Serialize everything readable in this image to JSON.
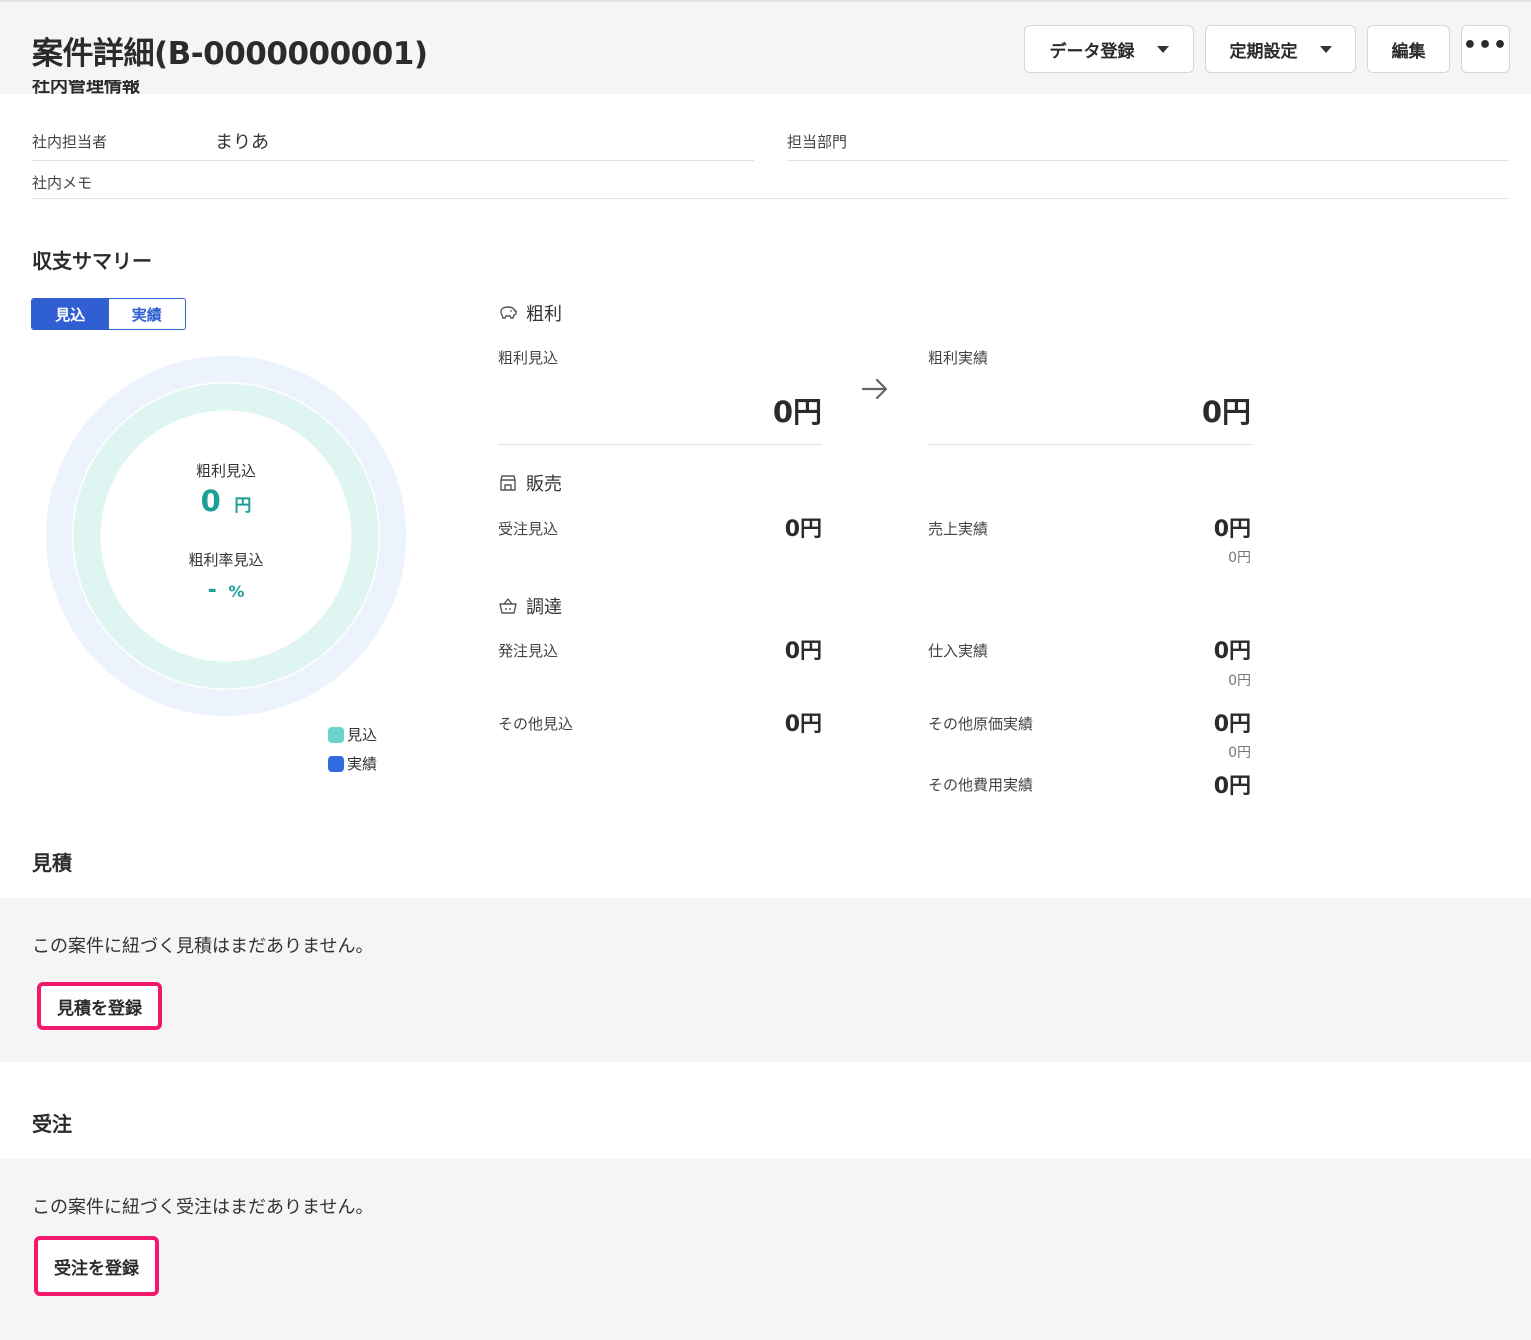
{
  "header": {
    "title": "案件詳細(B-0000000001)",
    "buttons": {
      "data_register": "データ登録",
      "periodic_setting": "定期設定",
      "edit": "編集",
      "more": "•••"
    }
  },
  "internal": {
    "section_title_cut": "社内管理情報",
    "person_label": "社内担当者",
    "person_value": "まりあ",
    "dept_label": "担当部門",
    "memo_label": "社内メモ"
  },
  "summary": {
    "title": "収支サマリー",
    "toggle": {
      "forecast": "見込",
      "actual": "実績"
    },
    "donut": {
      "profit_label": "粗利見込",
      "profit_value": "0",
      "profit_unit": "円",
      "rate_label": "粗利率見込",
      "rate_value": "-",
      "rate_unit": "%"
    },
    "legend": [
      {
        "label": "見込",
        "color": "#6cd3cf"
      },
      {
        "label": "実績",
        "color": "#2f6be0"
      }
    ],
    "profit": {
      "category": "粗利",
      "forecast_label": "粗利見込",
      "forecast_value": "0円",
      "actual_label": "粗利実績",
      "actual_value": "0円"
    },
    "sales": {
      "category": "販売",
      "forecast_label": "受注見込",
      "forecast_value": "0円",
      "actual_label": "売上実績",
      "actual_value": "0円",
      "actual_sub": "0円"
    },
    "procurement": {
      "category": "調達",
      "forecast_label": "発注見込",
      "forecast_value": "0円",
      "actual_label": "仕入実績",
      "actual_value": "0円",
      "actual_sub": "0円"
    },
    "other": {
      "forecast_label": "その他見込",
      "forecast_value": "0円",
      "cost_label": "その他原価実績",
      "cost_value": "0円",
      "cost_sub": "0円",
      "expense_label": "その他費用実績",
      "expense_value": "0円"
    }
  },
  "estimate": {
    "title": "見積",
    "empty_text": "この案件に紐づく見積はまだありません。",
    "button": "見積を登録"
  },
  "order": {
    "title": "受注",
    "empty_text": "この案件に紐づく受注はまだありません。",
    "button": "受注を登録"
  }
}
